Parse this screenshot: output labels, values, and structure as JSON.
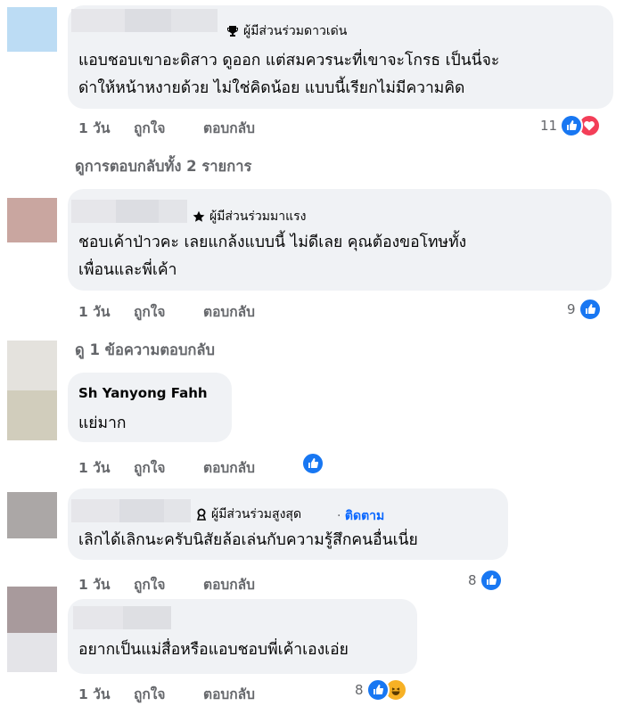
{
  "comments": [
    {
      "badge": "ผู้มีส่วนร่วมดาวเด่น",
      "lines": [
        "แอบชอบเขาอะดิสาว ดูออก แต่สมควรนะที่เขาจะโกรธ เป็นนี่จะ",
        "ด่าให้หน้าหงายด้วย ไม่ใช่คิดน้อย แบบนี้เรียกไม่มีความคิด"
      ],
      "time": "1 วัน",
      "like": "ถูกใจ",
      "reply": "ตอบกลับ",
      "reaction_count": "11",
      "reactions": [
        "like",
        "love"
      ],
      "view_replies": "ดูการตอบกลับทั้ง 2 รายการ"
    },
    {
      "badge": "ผู้มีส่วนร่วมมาแรง",
      "lines": [
        "ชอบเค้าป่าวคะ เลยแกล้งแบบนี้ ไม่ดีเลย คุณต้องขอโทษทั้ง",
        "เพื่อนและพี่เค้า"
      ],
      "time": "1 วัน",
      "like": "ถูกใจ",
      "reply": "ตอบกลับ",
      "reaction_count": "9",
      "reactions": [
        "like"
      ],
      "view_replies": "ดู 1 ข้อความตอบกลับ"
    },
    {
      "name_partial": "Sh Yanyong Fahh",
      "lines": [
        "แย่มาก"
      ],
      "time": "1 วัน",
      "like": "ถูกใจ",
      "reply": "ตอบกลับ",
      "reaction_count": "",
      "reactions": [
        "like"
      ]
    },
    {
      "badge": "ผู้มีส่วนร่วมสูงสุด",
      "follow": "ติดตาม",
      "lines": [
        "เลิกได้เลิกนะครับนิสัยล้อเล่นกับความรู้สึกคนอื่นเนี่ย"
      ],
      "time": "1 วัน",
      "like": "ถูกใจ",
      "reply": "ตอบกลับ",
      "reaction_count": "8",
      "reactions": [
        "like"
      ]
    },
    {
      "lines": [
        "อยากเป็นแม่สื่อหรือแอบชอบพี่เค้าเองเอ่ย"
      ],
      "time": "1 วัน",
      "like": "ถูกใจ",
      "reply": "ตอบกลับ",
      "reaction_count": "8",
      "reactions": [
        "like",
        "haha"
      ]
    }
  ],
  "colors": {
    "bubble": "#f0f2f5",
    "muted": "#65676b",
    "like": "#1877f2",
    "love": "#f33e58",
    "haha": "#f7b125",
    "link": "#0866ff"
  }
}
